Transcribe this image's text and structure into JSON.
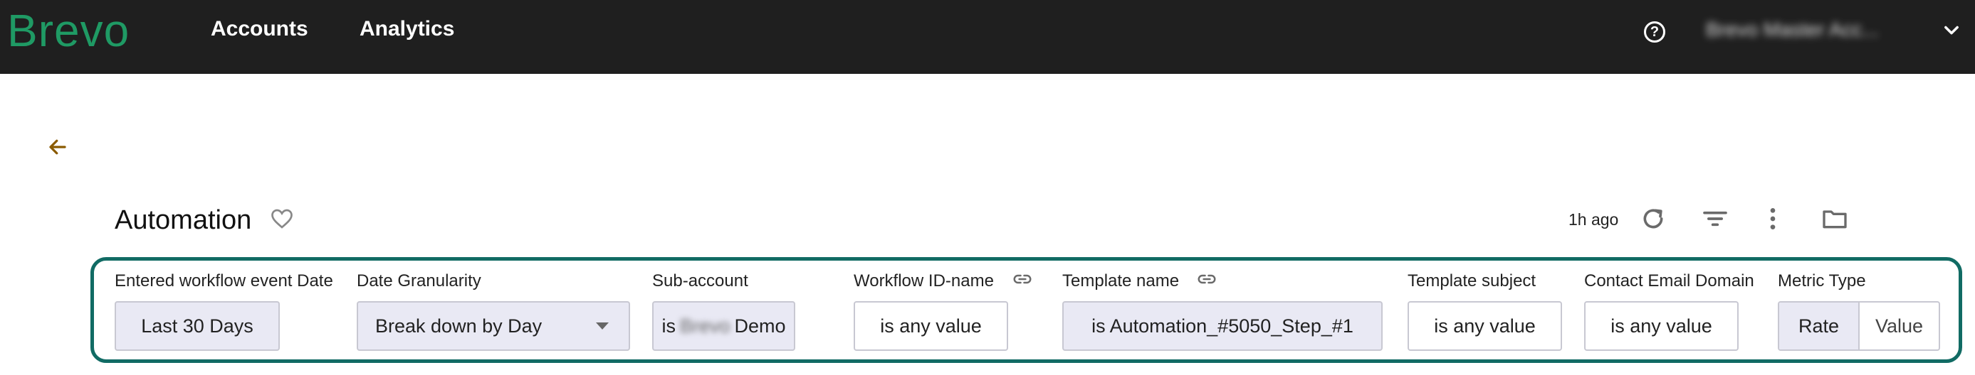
{
  "topbar": {
    "brand": "Brevo",
    "nav": [
      {
        "label": "Accounts"
      },
      {
        "label": "Analytics"
      }
    ],
    "help_icon": "question-circle-icon",
    "account_name": "Brevo Master Acc..."
  },
  "page": {
    "title": "Automation",
    "updated": "1h ago"
  },
  "filters": [
    {
      "label": "Entered workflow event Date",
      "value": "Last 30 Days"
    },
    {
      "label": "Date Granularity",
      "value": "Break down by Day"
    },
    {
      "label": "Sub-account",
      "value_prefix": "is",
      "value_hidden": "Brevo",
      "value_suffix": "Demo"
    },
    {
      "label": "Workflow ID-name",
      "value": "is any value"
    },
    {
      "label": "Template name",
      "value": "is Automation_#5050_Step_#1"
    },
    {
      "label": "Template subject",
      "value": "is any value"
    },
    {
      "label": "Contact Email Domain",
      "value": "is any value"
    },
    {
      "label": "Metric Type",
      "options": [
        "Rate",
        "Value"
      ],
      "selected": "Rate"
    }
  ],
  "colors": {
    "topbar": "#1f1f1f",
    "brand": "#1f9a64",
    "filter_border": "#116b64",
    "back_arrow": "#8a5a00"
  }
}
